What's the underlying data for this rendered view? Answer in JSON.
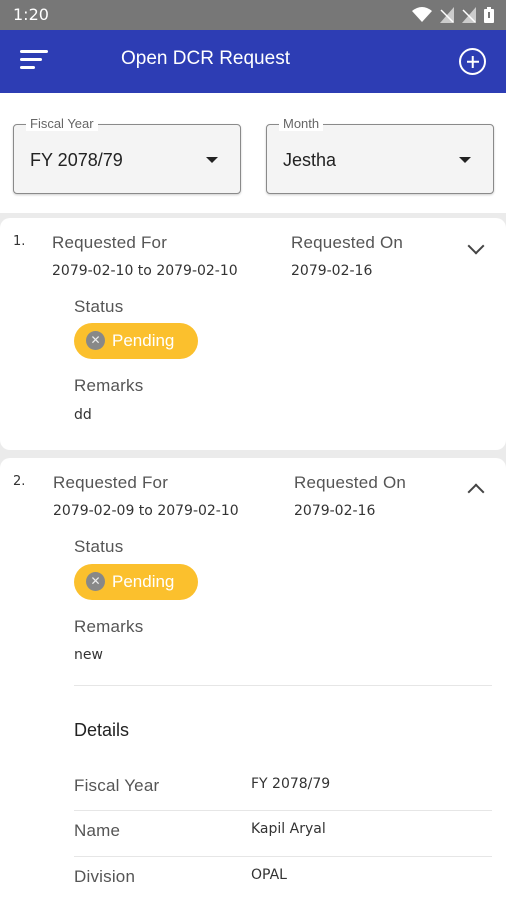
{
  "status_bar": {
    "time": "1:20",
    "icons": [
      "wifi-icon",
      "signal-off-icon",
      "signal-off-icon",
      "battery-icon"
    ]
  },
  "app_bar": {
    "title": "Open DCR Request",
    "menu_icon": "menu-icon",
    "add_icon": "add-circle-icon"
  },
  "filters": {
    "fiscal_year": {
      "label": "Fiscal Year",
      "value": "FY 2078/79"
    },
    "month": {
      "label": "Month",
      "value": "Jestha"
    }
  },
  "labels": {
    "requested_for": "Requested For",
    "requested_on": "Requested On",
    "status": "Status",
    "remarks": "Remarks",
    "details": "Details",
    "fiscal_year": "Fiscal Year",
    "name": "Name",
    "division": "Division"
  },
  "requests": [
    {
      "index": "1.",
      "requested_for": "2079-02-10 to 2079-02-10",
      "requested_on": "2079-02-16",
      "status": "Pending",
      "remarks": "dd",
      "expanded": false
    },
    {
      "index": "2.",
      "requested_for": "2079-02-09 to 2079-02-10",
      "requested_on": "2079-02-16",
      "status": "Pending",
      "remarks": "new",
      "expanded": true,
      "details": {
        "fiscal_year": "FY 2078/79",
        "name": "Kapil Aryal",
        "division": "OPAL"
      }
    }
  ],
  "colors": {
    "app_bar": "#2d3db4",
    "status_pending": "#fbc02d",
    "status_bar": "#777777"
  }
}
